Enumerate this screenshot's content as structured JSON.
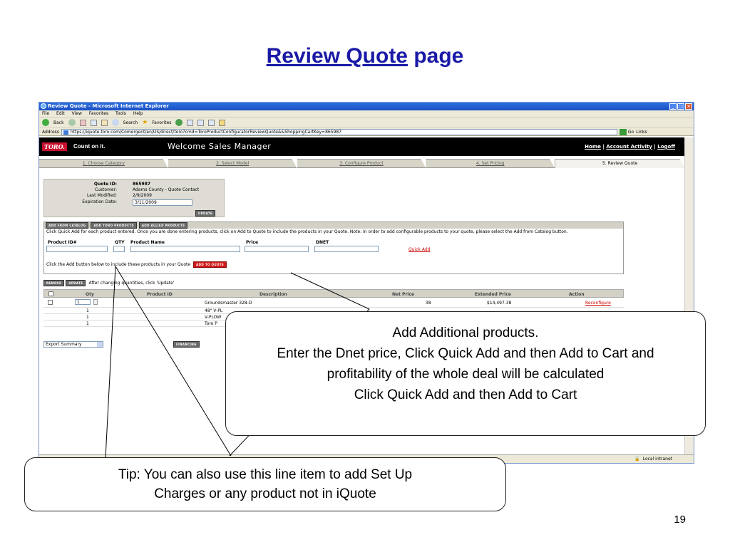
{
  "slide": {
    "title_link": "Review Quote",
    "title_rest": "page",
    "page_number": "19"
  },
  "browser": {
    "window_title": "Review Quote - Microsoft Internet Explorer",
    "menu": [
      "File",
      "Edit",
      "View",
      "Favorites",
      "Tools",
      "Help"
    ],
    "toolbar": {
      "back": "Back",
      "search": "Search",
      "favorites": "Favorites"
    },
    "address_label": "Address",
    "url": "https://iquote.toro.com/Comergent/en/US/direct/toro?cmd=ToroProductConfiguratorReviewQuote&&ShoppingCartKey=865987",
    "go": "Go",
    "links": "Links",
    "status_zone": "Local intranet"
  },
  "header": {
    "logo": "TORO.",
    "tagline": "Count on it.",
    "welcome": "Welcome  Sales Manager",
    "links": [
      "Home",
      "Account Activity",
      "Logoff"
    ]
  },
  "steps": [
    {
      "label": "1. Choose Category",
      "active": false
    },
    {
      "label": "2. Select Model",
      "active": false
    },
    {
      "label": "3. Configure Product",
      "active": false
    },
    {
      "label": "4. Set Pricing",
      "active": false
    },
    {
      "label": "5. Review Quote",
      "active": true
    }
  ],
  "quote": {
    "id_label": "Quote ID:",
    "id": "865987",
    "customer_label": "Customer:",
    "customer": "Adams County - Quote Contact",
    "modified_label": "Last Modified:",
    "modified": "2/9/2009",
    "expiration_label": "Expiration Date:",
    "expiration": "3/11/2009",
    "update_button": "UPDATE"
  },
  "catalog": {
    "buttons": [
      "ADD FROM CATALOG",
      "ADD TORO PRODUCTS",
      "ADD ALLIED PRODUCTS"
    ],
    "note": "Click Quick Add for each product entered. Once you are done entering products, click on Add to Quote to include the products in your Quote. Note: In order to add configurable products to your quote, please select the Add from Catalog button.",
    "fields": {
      "product_id": "Product ID#",
      "qty": "QTY",
      "product_name": "Product Name",
      "price": "Price",
      "dnet": "DNET"
    },
    "quick_add": "Quick Add",
    "add_instruction": "Click the Add button below to include these products in your Quote",
    "add_to_quote": "ADD TO QUOTE"
  },
  "cart": {
    "remove_button": "REMOVE",
    "update_button": "UPDATE",
    "after_changing": "After changing quantities, click 'Update'",
    "columns": [
      "Qty",
      "Product ID",
      "Description",
      "Net Price",
      "Extended Price",
      "Action"
    ],
    "rows": [
      {
        "qty": "1",
        "description": "Groundsmaster 328-D",
        "net_price": "38",
        "extended_price": "$14,497.38",
        "action": "Reconfigure"
      },
      {
        "qty": "1",
        "description": "48\" V-PL"
      },
      {
        "qty": "1",
        "description": "V-PLOW"
      },
      {
        "qty": "1",
        "description": "Toro P"
      }
    ],
    "export_select": "Export Summary",
    "financing_button": "FINANCING"
  },
  "callouts": {
    "main": [
      "Add Additional products.",
      "Enter the Dnet price, Click Quick Add and then Add to Cart and",
      "profitability of the whole deal will be calculated",
      "Click Quick Add and then Add to Cart"
    ],
    "tip": [
      "Tip: You can also use this line item to add Set Up",
      "Charges or any product not in iQuote"
    ]
  }
}
